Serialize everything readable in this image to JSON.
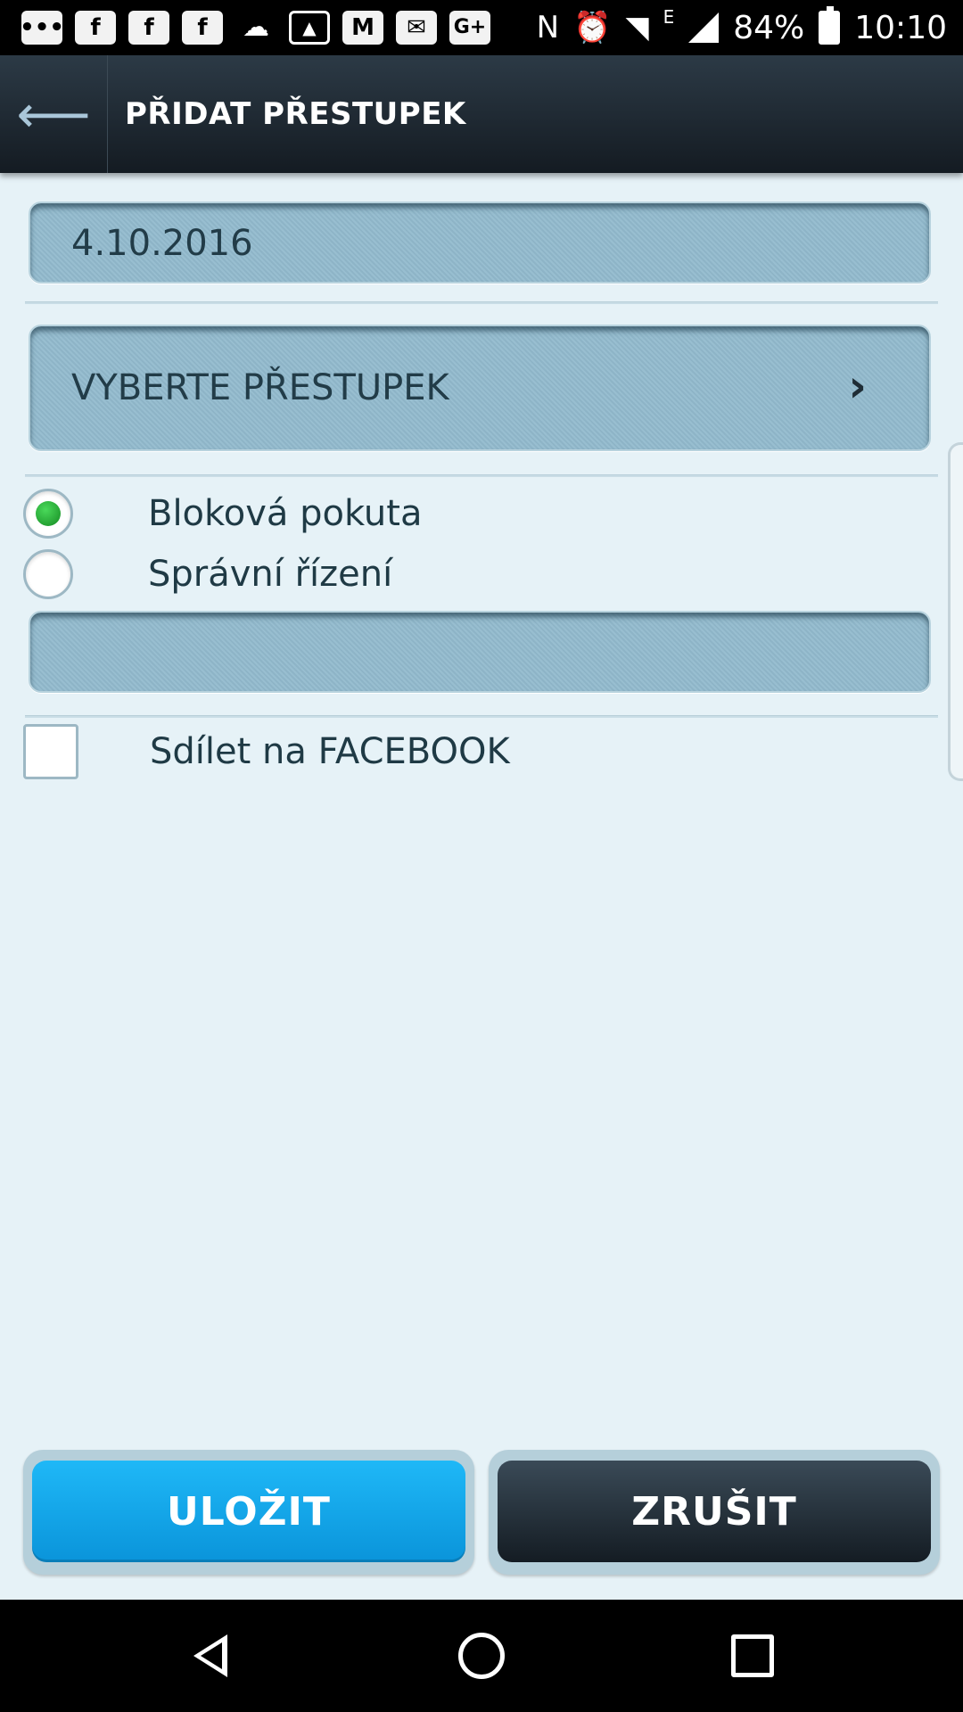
{
  "status_bar": {
    "left_icons": [
      "messages-icon",
      "facebook-icon",
      "facebook-icon",
      "facebook-icon",
      "weather-icon",
      "gallery-icon",
      "gmail-icon",
      "email-icon",
      "google-plus-icon"
    ],
    "battery": "84%",
    "time": "10:10",
    "network": "E"
  },
  "toolbar": {
    "title": "PŘIDAT PŘESTUPEK",
    "back_icon": "back-arrow-icon"
  },
  "form": {
    "date_value": "4.10.2016",
    "offense_select": "VYBERTE PŘESTUPEK",
    "penalty_options": [
      {
        "label": "Bloková pokuta",
        "selected": true
      },
      {
        "label": "Správní řízení",
        "selected": false
      }
    ],
    "amount_value": "",
    "share_label": "Sdílet na FACEBOOK",
    "share_checked": false
  },
  "buttons": {
    "save_label": "ULOŽIT",
    "cancel_label": "ZRUŠIT"
  },
  "colors": {
    "accent": "#0fa6ea",
    "toolbar": "#1c252e",
    "field": "#92bacd",
    "background": "#e6f2f7",
    "radio_selected": "#22a633"
  }
}
